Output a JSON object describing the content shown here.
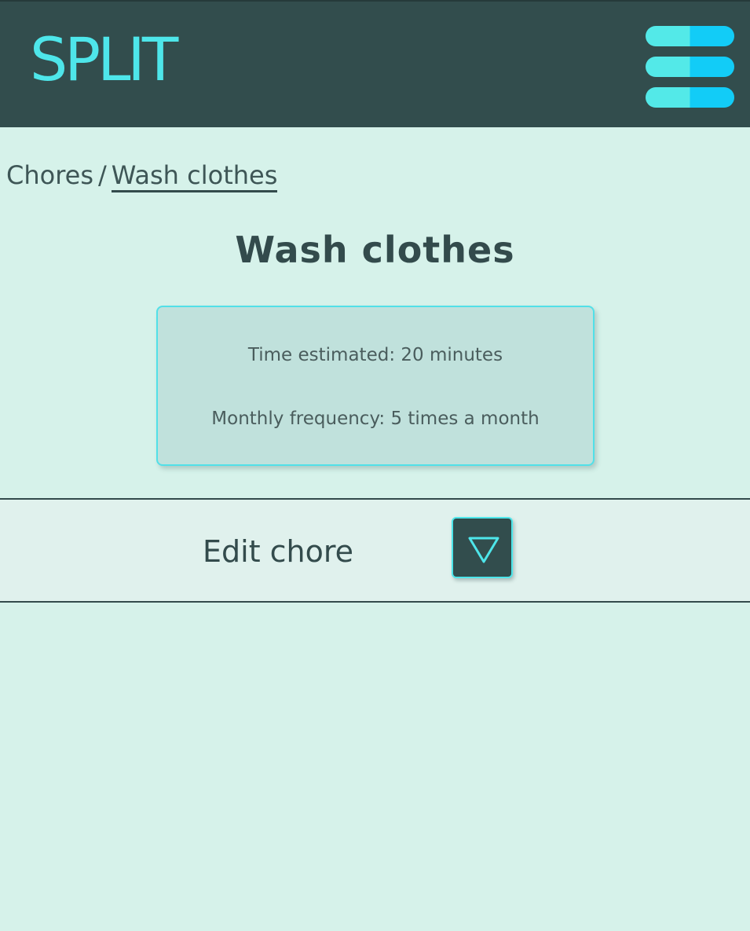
{
  "header": {
    "logo_text": "SPLIT",
    "logo_color": "#4ee6ea",
    "background_color": "#324d4d",
    "menu_icon": "hamburger-menu-icon"
  },
  "breadcrumb": {
    "parent_label": "Chores",
    "separator": "/",
    "current_label": "Wash clothes"
  },
  "page": {
    "title": "Wash clothes",
    "background_color": "#d6f2ea"
  },
  "chore_details": {
    "time_estimated": "Time estimated: 20 minutes",
    "monthly_frequency": "Monthly frequency: 5 times a month"
  },
  "edit_section": {
    "label": "Edit chore",
    "toggle_icon": "triangle-down-icon",
    "expanded": false
  }
}
